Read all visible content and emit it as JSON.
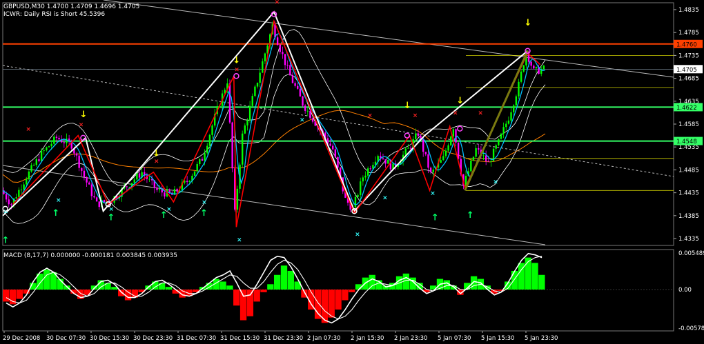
{
  "header": {
    "symbol_line": "GBPUSD,M30  1.4700 1.4709 1.4696 1.4705",
    "indicator_line": "ICWR: Daily RSI is Short 45.5396"
  },
  "macd": {
    "label": "MACD  (8,17,7) 0.000000 -0.000181 0.003845 0.003935",
    "axis_labels": [
      "0.005489",
      "0.00",
      "-0.00578"
    ]
  },
  "colors": {
    "background": "#000000",
    "grid": "#444444",
    "bull_candle": "#00ff00",
    "bear_candle": "#ff00ff",
    "zigzag_white": "#ffffff",
    "zigzag_red": "#ff0000",
    "fast_line": "#00bfff",
    "bands": "#ffffff",
    "slow_ma": "#ff8000",
    "level_red": "#ff4000",
    "level_green": "#33ff66",
    "fib_yellow": "#cccc00",
    "down_arrow": "#ffff00",
    "up_arrow": "#00ff66",
    "cross_cyan": "#33ffff",
    "cross_red": "#ff2222",
    "hist_pos": "#00ff00",
    "hist_neg": "#ff0000"
  },
  "chart_data": {
    "type": "candlestick",
    "price_axis": {
      "ticks": [
        "1.4835",
        "1.4785",
        "1.4735",
        "1.4685",
        "1.4635",
        "1.4585",
        "1.4535",
        "1.4485",
        "1.4435",
        "1.4385",
        "1.4335"
      ],
      "ylim": [
        1.432,
        1.485
      ]
    },
    "level_labels": [
      {
        "value": 1.476,
        "label": "1.4760",
        "color": "#ff4000"
      },
      {
        "value": 1.4705,
        "label": "1.4705",
        "color": "#ffffff"
      },
      {
        "value": 1.4622,
        "label": "1.4622",
        "color": "#33ff66"
      },
      {
        "value": 1.4548,
        "label": "1.4548",
        "color": "#33ff66"
      }
    ],
    "time_labels": [
      "29 Dec 2008",
      "30 Dec 07:30",
      "30 Dec 15:30",
      "30 Dec 23:30",
      "31 Dec 07:30",
      "31 Dec 15:30",
      "31 Dec 23:30",
      "2 Jan 07:30",
      "2 Jan 15:30",
      "2 Jan 23:30",
      "5 Jan 07:30",
      "5 Jan 15:30",
      "5 Jan 23:30"
    ],
    "price_path": [
      {
        "x": 0,
        "y": 1.444
      },
      {
        "x": 4,
        "y": 1.441
      },
      {
        "x": 10,
        "y": 1.447
      },
      {
        "x": 16,
        "y": 1.452
      },
      {
        "x": 22,
        "y": 1.4555
      },
      {
        "x": 28,
        "y": 1.454
      },
      {
        "x": 33,
        "y": 1.447
      },
      {
        "x": 38,
        "y": 1.441
      },
      {
        "x": 44,
        "y": 1.442
      },
      {
        "x": 50,
        "y": 1.445
      },
      {
        "x": 56,
        "y": 1.448
      },
      {
        "x": 62,
        "y": 1.444
      },
      {
        "x": 68,
        "y": 1.443
      },
      {
        "x": 74,
        "y": 1.446
      },
      {
        "x": 80,
        "y": 1.451
      },
      {
        "x": 85,
        "y": 1.46
      },
      {
        "x": 90,
        "y": 1.468
      },
      {
        "x": 93,
        "y": 1.439
      },
      {
        "x": 96,
        "y": 1.456
      },
      {
        "x": 100,
        "y": 1.464
      },
      {
        "x": 104,
        "y": 1.472
      },
      {
        "x": 108,
        "y": 1.48
      },
      {
        "x": 111,
        "y": 1.475
      },
      {
        "x": 115,
        "y": 1.469
      },
      {
        "x": 120,
        "y": 1.463
      },
      {
        "x": 126,
        "y": 1.458
      },
      {
        "x": 132,
        "y": 1.453
      },
      {
        "x": 137,
        "y": 1.442
      },
      {
        "x": 140,
        "y": 1.44
      },
      {
        "x": 144,
        "y": 1.447
      },
      {
        "x": 150,
        "y": 1.452
      },
      {
        "x": 156,
        "y": 1.449
      },
      {
        "x": 162,
        "y": 1.453
      },
      {
        "x": 166,
        "y": 1.4565
      },
      {
        "x": 171,
        "y": 1.4475
      },
      {
        "x": 176,
        "y": 1.451
      },
      {
        "x": 180,
        "y": 1.458
      },
      {
        "x": 184,
        "y": 1.445
      },
      {
        "x": 189,
        "y": 1.453
      },
      {
        "x": 194,
        "y": 1.45
      },
      {
        "x": 198,
        "y": 1.4545
      },
      {
        "x": 202,
        "y": 1.46
      },
      {
        "x": 206,
        "y": 1.467
      },
      {
        "x": 209,
        "y": 1.4745
      },
      {
        "x": 212,
        "y": 1.47
      },
      {
        "x": 216,
        "y": 1.4705
      }
    ],
    "macd_hist": [
      -0.0018,
      -0.0022,
      -0.0014,
      -0.0006,
      0.001,
      0.0024,
      0.003,
      0.0026,
      0.0016,
      0.0006,
      -0.0006,
      -0.0014,
      -0.0008,
      0.0006,
      0.0014,
      0.001,
      0.0004,
      -0.001,
      -0.0016,
      -0.0012,
      -0.0004,
      0.0006,
      0.0012,
      0.001,
      0.0004,
      -0.0006,
      -0.0012,
      -0.001,
      -0.0004,
      0.0004,
      0.001,
      0.0016,
      0.0012,
      0.0006,
      -0.0024,
      -0.0046,
      -0.004,
      -0.0018,
      -0.0004,
      0.0008,
      0.0022,
      0.0036,
      0.0028,
      0.0012,
      -0.0012,
      -0.003,
      -0.0044,
      -0.005,
      -0.0042,
      -0.003,
      -0.0016,
      -0.0004,
      0.0008,
      0.0018,
      0.0022,
      0.0014,
      0.0006,
      0.001,
      0.002,
      0.0024,
      0.0018,
      0.001,
      -0.0004,
      0.0006,
      0.0016,
      0.0014,
      0.0006,
      -0.0008,
      0.001,
      0.002,
      0.0016,
      0.0006,
      -0.0006,
      -0.0002,
      0.0012,
      0.0028,
      0.004,
      0.0048,
      0.004,
      0.0022
    ],
    "macd_line": [
      -0.002,
      -0.0026,
      -0.002,
      -0.0008,
      0.0012,
      0.0026,
      0.0032,
      0.0026,
      0.0014,
      0.0004,
      -0.0006,
      -0.0012,
      -0.001,
      0.0002,
      0.0012,
      0.0014,
      0.0008,
      -0.0004,
      -0.0012,
      -0.0012,
      -0.0006,
      0.0004,
      0.0012,
      0.0014,
      0.0008,
      0.0,
      -0.0008,
      -0.001,
      -0.0006,
      0.0002,
      0.001,
      0.0018,
      0.0022,
      0.0028,
      0.001,
      -0.001,
      -0.0008,
      0.0008,
      0.0026,
      0.0044,
      0.005,
      0.0048,
      0.0034,
      0.0016,
      -0.0004,
      -0.0022,
      -0.0036,
      -0.0046,
      -0.005,
      -0.0044,
      -0.003,
      -0.0014,
      0.0,
      0.001,
      0.0016,
      0.0012,
      0.0004,
      0.0006,
      0.0014,
      0.0018,
      0.0012,
      0.0002,
      -0.0006,
      -0.0002,
      0.0008,
      0.001,
      0.0004,
      -0.0006,
      0.0002,
      0.0012,
      0.001,
      0.0,
      -0.0008,
      -0.0004,
      0.001,
      0.0028,
      0.0044,
      0.0054,
      0.0052,
      0.0048
    ],
    "macd_signal": [
      -0.0012,
      -0.0018,
      -0.002,
      -0.0016,
      -0.0004,
      0.001,
      0.0022,
      0.0026,
      0.0022,
      0.0014,
      0.0004,
      -0.0006,
      -0.001,
      -0.0006,
      0.0004,
      0.001,
      0.001,
      0.0004,
      -0.0004,
      -0.001,
      -0.001,
      -0.0004,
      0.0004,
      0.001,
      0.001,
      0.0006,
      -0.0002,
      -0.0006,
      -0.0006,
      -0.0002,
      0.0004,
      0.001,
      0.0016,
      0.0022,
      0.002,
      0.001,
      0.0002,
      0.0002,
      0.0012,
      0.0026,
      0.0038,
      0.0044,
      0.004,
      0.003,
      0.0014,
      -0.0004,
      -0.002,
      -0.0032,
      -0.004,
      -0.0044,
      -0.004,
      -0.003,
      -0.0016,
      -0.0004,
      0.0006,
      0.001,
      0.0008,
      0.0006,
      0.001,
      0.0014,
      0.0014,
      0.0008,
      0.0,
      -0.0002,
      0.0002,
      0.0006,
      0.0006,
      0.0,
      0.0,
      0.0006,
      0.0008,
      0.0004,
      -0.0002,
      -0.0004,
      0.0002,
      0.0016,
      0.003,
      0.0042,
      0.0048,
      0.005
    ],
    "macd_ylim": [
      -0.0062,
      0.006
    ]
  }
}
